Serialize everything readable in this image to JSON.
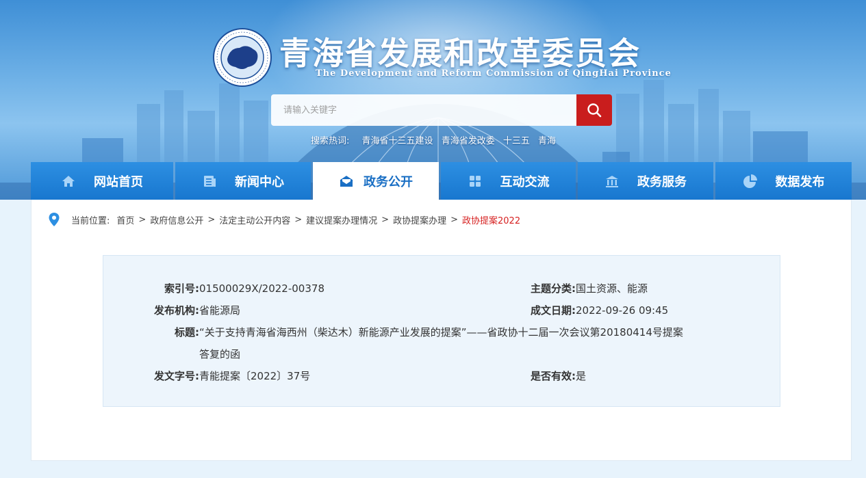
{
  "header": {
    "title": "青海省发展和改革委员会",
    "subtitle": "The Development and Reform Commission of QingHai Province",
    "logo_ring_text": "青海省发展和改革委员会",
    "search_placeholder": "请输入关键字",
    "hotwords_label": "搜索热词:",
    "hotwords": [
      "青海省十三五建设",
      "青海省发改委",
      "十三五",
      "青海"
    ]
  },
  "nav": {
    "items": [
      {
        "label": "网站首页",
        "icon": "home-icon"
      },
      {
        "label": "新闻中心",
        "icon": "news-icon"
      },
      {
        "label": "政务公开",
        "icon": "mail-open-icon",
        "active": true
      },
      {
        "label": "互动交流",
        "icon": "grid-icon"
      },
      {
        "label": "政务服务",
        "icon": "bank-icon"
      },
      {
        "label": "数据发布",
        "icon": "pie-chart-icon"
      }
    ]
  },
  "breadcrumb": {
    "label": "当前位置:",
    "items": [
      "首页",
      "政府信息公开",
      "法定主动公开内容",
      "建议提案办理情况",
      "政协提案办理"
    ],
    "current": "政协提案2022",
    "separator": ">"
  },
  "meta": {
    "index_key": "索引号:",
    "index_val": "01500029X/2022-00378",
    "topic_key": "主题分类:",
    "topic_val": "国土资源、能源",
    "org_key": "发布机构:",
    "org_val": "省能源局",
    "date_key": "成文日期:",
    "date_val": "2022-09-26 09:45",
    "title_key": "标题:",
    "title_line1": "“关于支持青海省海西州（柴达木）新能源产业发展的提案”——省政协十二届一次会议第20180414号提案",
    "title_line2": "答复的函",
    "docno_key": "发文字号:",
    "docno_val": "青能提案〔2022〕37号",
    "valid_key": "是否有效:",
    "valid_val": "是"
  },
  "colors": {
    "nav_blue": "#1877cf",
    "nav_active_text": "#1a6fc4",
    "search_red": "#c91d1d",
    "crumb_current": "#d62020"
  }
}
